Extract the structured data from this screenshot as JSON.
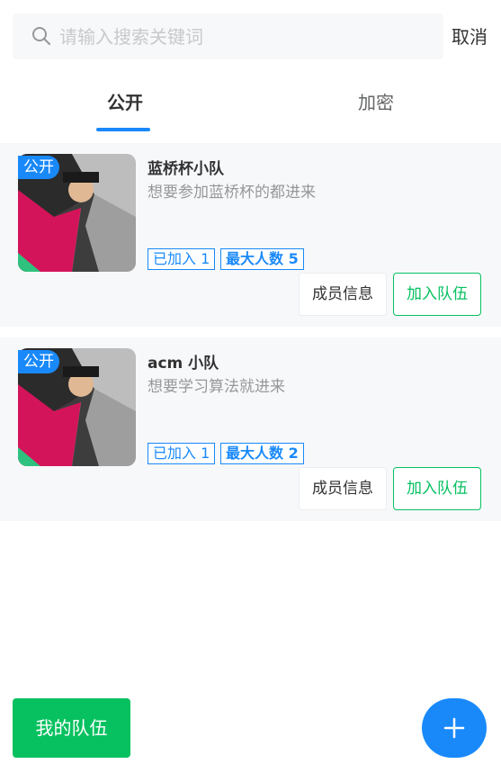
{
  "search": {
    "placeholder": "请输入搜索关键词",
    "value": "",
    "cancel_label": "取消"
  },
  "tabs": [
    {
      "label": "公开",
      "active": true
    },
    {
      "label": "加密",
      "active": false
    }
  ],
  "teams": [
    {
      "status_tag": "公开",
      "name": "蓝桥杯小队",
      "description": "想要参加蓝桥杯的都进来",
      "joined_label": "已加入 1",
      "max_label": "最大人数 5",
      "members_button": "成员信息",
      "join_button": "加入队伍"
    },
    {
      "status_tag": "公开",
      "name": "acm 小队",
      "description": "想要学习算法就进来",
      "joined_label": "已加入 1",
      "max_label": "最大人数 2",
      "members_button": "成员信息",
      "join_button": "加入队伍"
    }
  ],
  "footer": {
    "my_team_label": "我的队伍",
    "add_icon": "plus-icon"
  },
  "colors": {
    "primary": "#1989fa",
    "success": "#07c160",
    "card_bg": "#f7f8fa"
  }
}
